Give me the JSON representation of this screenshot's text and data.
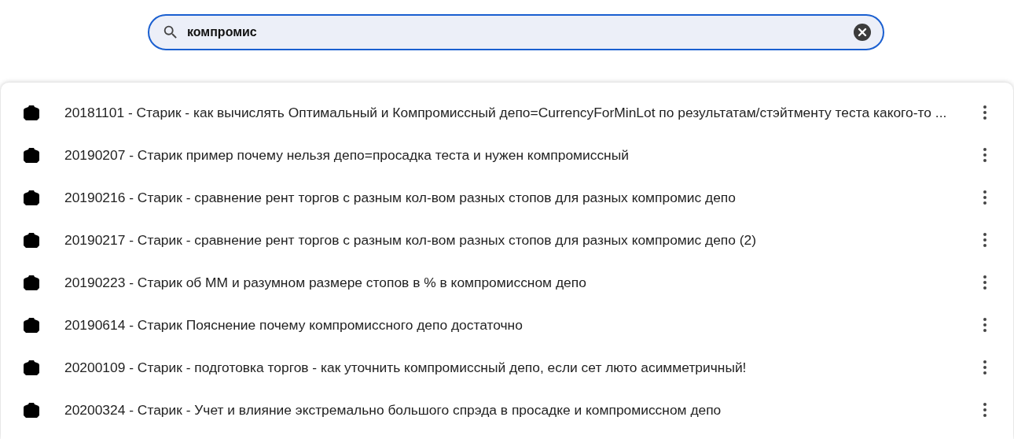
{
  "search": {
    "value": "компромис"
  },
  "results": [
    {
      "title": "20181101 - Старик - как вычислять Оптимальный и Компромиссный депо=CurrencyForMinLot по результатам/стэйтменту теста какого-то ..."
    },
    {
      "title": "20190207 - Старик пример почему нельзя депо=просадка теста и нужен компромиссный"
    },
    {
      "title": "20190216 - Старик - сравнение рент торгов с разным кол-вом разных стопов для разных компромис депо"
    },
    {
      "title": "20190217 - Старик - сравнение рент торгов с разным кол-вом разных стопов для разных компромис депо (2)"
    },
    {
      "title": "20190223 - Старик об ММ и разумном размере стопов в % в компромиссном депо"
    },
    {
      "title": "20190614 - Старик Пояснение почему компромиссного депо достаточно"
    },
    {
      "title": "20200109 - Старик - подготовка торгов - как уточнить компромиссный депо, если сет люто асимметричный!"
    },
    {
      "title": "20200324 - Старик - Учет и влияние экстремально большого спрэда в просадке и компромиссном депо"
    }
  ]
}
